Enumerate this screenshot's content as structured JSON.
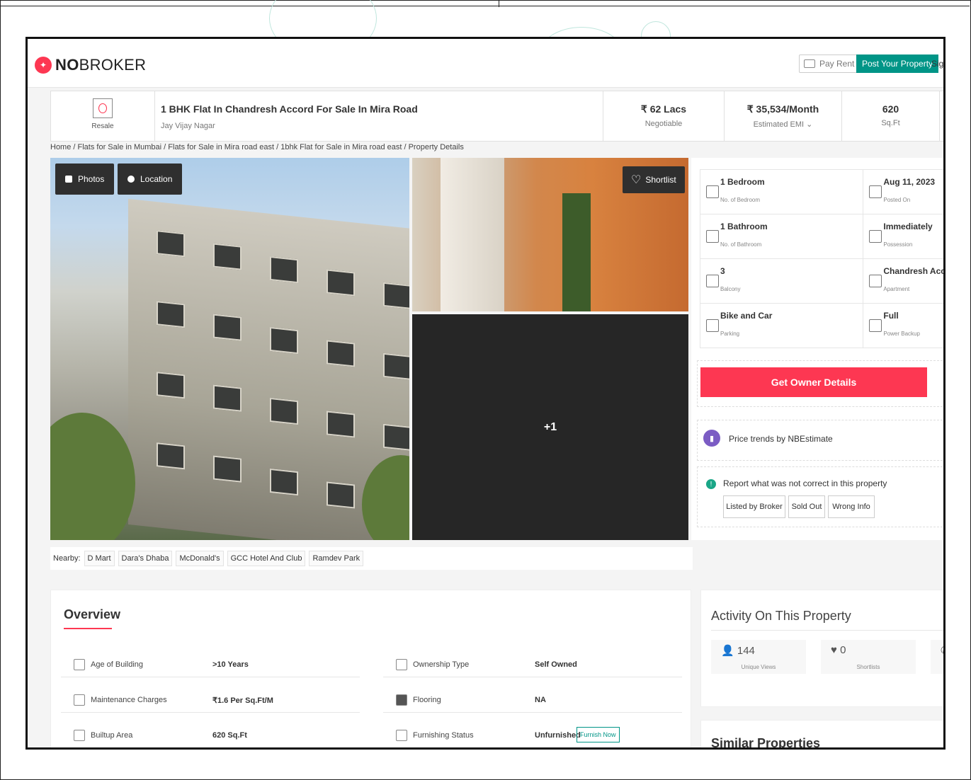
{
  "header": {
    "logo_prefix": "NO",
    "logo_suffix": "BROKER",
    "pay_rent": "Pay Rent",
    "post_property": "Post Your Property",
    "sign": "Sign"
  },
  "title_bar": {
    "badge": "Resale",
    "title": "1 BHK Flat In Chandresh Accord For Sale In Mira Road",
    "subtitle": "Jay Vijay Nagar",
    "price": "₹ 62 Lacs",
    "price_sub": "Negotiable",
    "emi": "₹ 35,534/Month",
    "emi_sub": "Estimated EMI ⌄",
    "area": "620",
    "area_sub": "Sq.Ft"
  },
  "breadcrumb": "Home / Flats for Sale in Mumbai / Flats for Sale in Mira road east / 1bhk Flat for Sale in Mira road east / Property Details",
  "gallery": {
    "photos": "Photos",
    "location": "Location",
    "shortlist": "Shortlist",
    "more": "+1"
  },
  "nearby": {
    "label": "Nearby:",
    "places": [
      "D Mart",
      "Dara's Dhaba",
      "McDonald's",
      "GCC Hotel And Club",
      "Ramdev Park"
    ]
  },
  "details": [
    {
      "title": "1 Bedroom",
      "sub": "No. of Bedroom"
    },
    {
      "title": "Aug 11, 2023",
      "sub": "Posted On"
    },
    {
      "title": "1 Bathroom",
      "sub": "No. of Bathroom"
    },
    {
      "title": "Immediately",
      "sub": "Possession"
    },
    {
      "title": "3",
      "sub": "Balcony"
    },
    {
      "title": "Chandresh Accord",
      "sub": "Apartment"
    },
    {
      "title": "Bike and Car",
      "sub": "Parking"
    },
    {
      "title": "Full",
      "sub": "Power Backup"
    }
  ],
  "owner_button": "Get Owner Details",
  "price_trends": "Price trends by NBEstimate",
  "report": {
    "text": "Report what was not correct in this property",
    "buttons": [
      "Listed by Broker",
      "Sold Out",
      "Wrong Info"
    ]
  },
  "overview": {
    "title": "Overview",
    "rows": [
      {
        "key": "Age of Building",
        "value": ">10 Years"
      },
      {
        "key": "Ownership Type",
        "value": "Self Owned"
      },
      {
        "key": "Maintenance Charges",
        "value": "₹1.6 Per Sq.Ft/M"
      },
      {
        "key": "Flooring",
        "value": "NA"
      },
      {
        "key": "Builtup Area",
        "value": "620 Sq.Ft"
      },
      {
        "key": "Furnishing Status",
        "value": "Unfurnished"
      }
    ],
    "furnish_now": "Furnish Now"
  },
  "activity": {
    "title": "Activity On This Property",
    "views": "144",
    "views_label": "Unique Views",
    "shortlists": "0",
    "shortlists_label": "Shortlists"
  },
  "similar_title": "Similar Properties",
  "colors": {
    "brand": "#fd3752",
    "accent": "#009587"
  }
}
